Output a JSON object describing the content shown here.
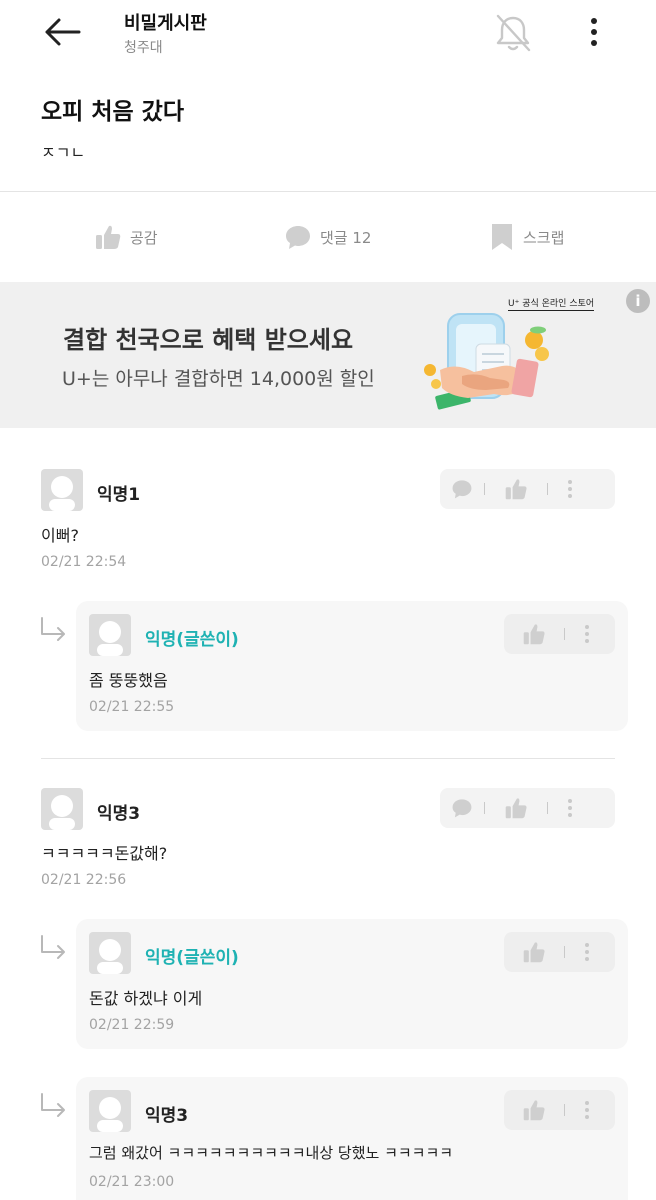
{
  "header": {
    "board_title": "비밀게시판",
    "board_subtitle": "청주대",
    "icons": [
      "back-arrow-icon",
      "bell-off-icon",
      "more-vertical-icon"
    ]
  },
  "post": {
    "title": "오피 처음 갔다",
    "body": "ㅈㄱㄴ"
  },
  "actions": {
    "like_label": "공감",
    "comment_label": "댓글 12",
    "scrap_label": "스크랩"
  },
  "ad": {
    "headline": "결합 천국으로 혜택 받으세요",
    "subline": "U+는 아무나 결합하면 14,000원 할인",
    "brand": "U⁺ 공식 온라인 스토어",
    "info": "i"
  },
  "comments": [
    {
      "name": "익명1",
      "text": "이뻐?",
      "time": "02/21 22:54"
    },
    {
      "name": "익명(글쓴이)",
      "text": "좀 뚱뚱했음",
      "time": "02/21 22:55"
    },
    {
      "name": "익명3",
      "text": "ㅋㅋㅋㅋㅋ돈값해?",
      "time": "02/21 22:56"
    },
    {
      "name": "익명(글쓴이)",
      "text": "돈값 하겠냐 이게",
      "time": "02/21 22:59"
    },
    {
      "name": "익명3",
      "text": "그럼 왜갔어 ㅋㅋㅋㅋㅋㅋㅋㅋㅋㅋ내상 당했노 ㅋㅋㅋㅋㅋ",
      "time": "02/21 23:00"
    }
  ],
  "colors": {
    "accent_writer": "#1fb2b3",
    "muted_text": "#8a8a8a",
    "ad_background": "#f0f0f0"
  }
}
